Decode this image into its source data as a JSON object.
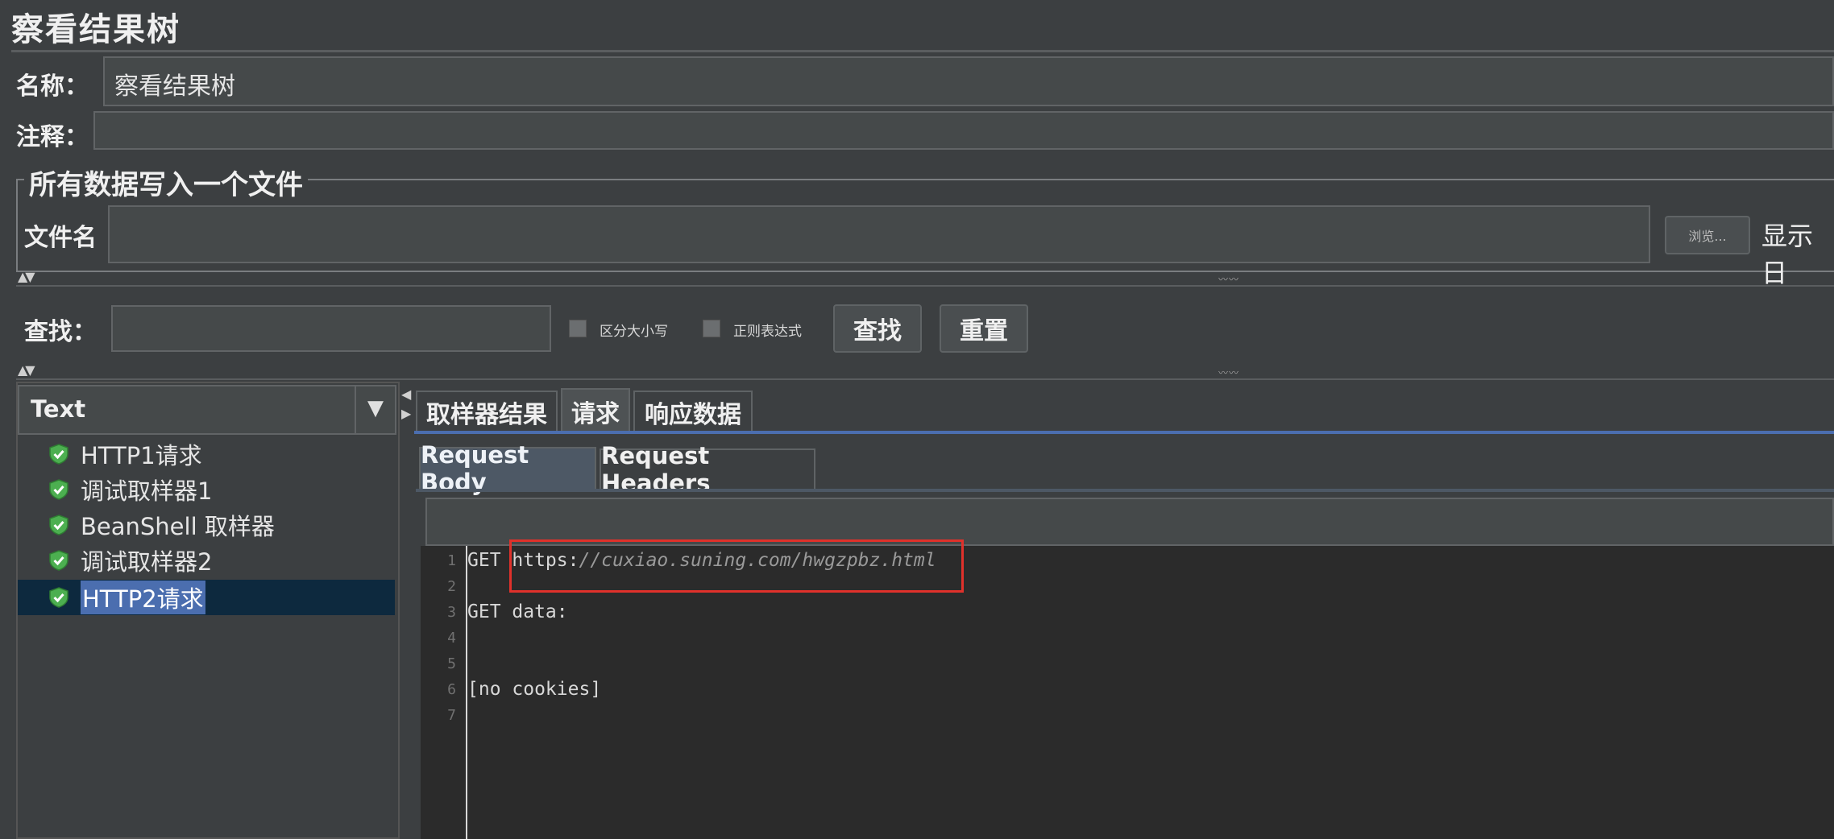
{
  "title": "察看结果树",
  "name": {
    "label": "名称：",
    "value": "察看结果树"
  },
  "comment": {
    "label": "注释：",
    "value": ""
  },
  "file_group": {
    "title": "所有数据写入一个文件",
    "filename_label": "文件名",
    "filename_value": "",
    "browse_label": "浏览...",
    "show_log_label": "显示日"
  },
  "search": {
    "label": "查找：",
    "value": "",
    "case_label": "区分大小写",
    "regex_label": "正则表达式",
    "find_button": "查找",
    "reset_button": "重置"
  },
  "renderer": {
    "selected": "Text"
  },
  "tree": [
    {
      "label": "HTTP1请求",
      "status": "success",
      "selected": false
    },
    {
      "label": "调试取样器1",
      "status": "success",
      "selected": false
    },
    {
      "label": "BeanShell 取样器",
      "status": "success",
      "selected": false
    },
    {
      "label": "调试取样器2",
      "status": "success",
      "selected": false
    },
    {
      "label": "HTTP2请求",
      "status": "success",
      "selected": true
    }
  ],
  "tabs": [
    {
      "label": "取样器结果",
      "active": false
    },
    {
      "label": "请求",
      "active": true
    },
    {
      "label": "响应数据",
      "active": false
    }
  ],
  "subtabs": [
    {
      "label": "Request Body",
      "active": true
    },
    {
      "label": "Request Headers",
      "active": false
    }
  ],
  "editor": {
    "line_numbers": [
      "1",
      "2",
      "3",
      "4",
      "5",
      "6",
      "7"
    ],
    "line1_method": "GET ",
    "line1_scheme": "https:",
    "line1_rest": "//cuxiao.suning.com/hwgzpbz.html",
    "line3": "GET data:",
    "line6": "[no cookies]"
  },
  "colors": {
    "background": "#3c3f41",
    "selection": "#4b6eaf",
    "highlight_box": "#e0312b",
    "success_icon": "#4caf50"
  }
}
